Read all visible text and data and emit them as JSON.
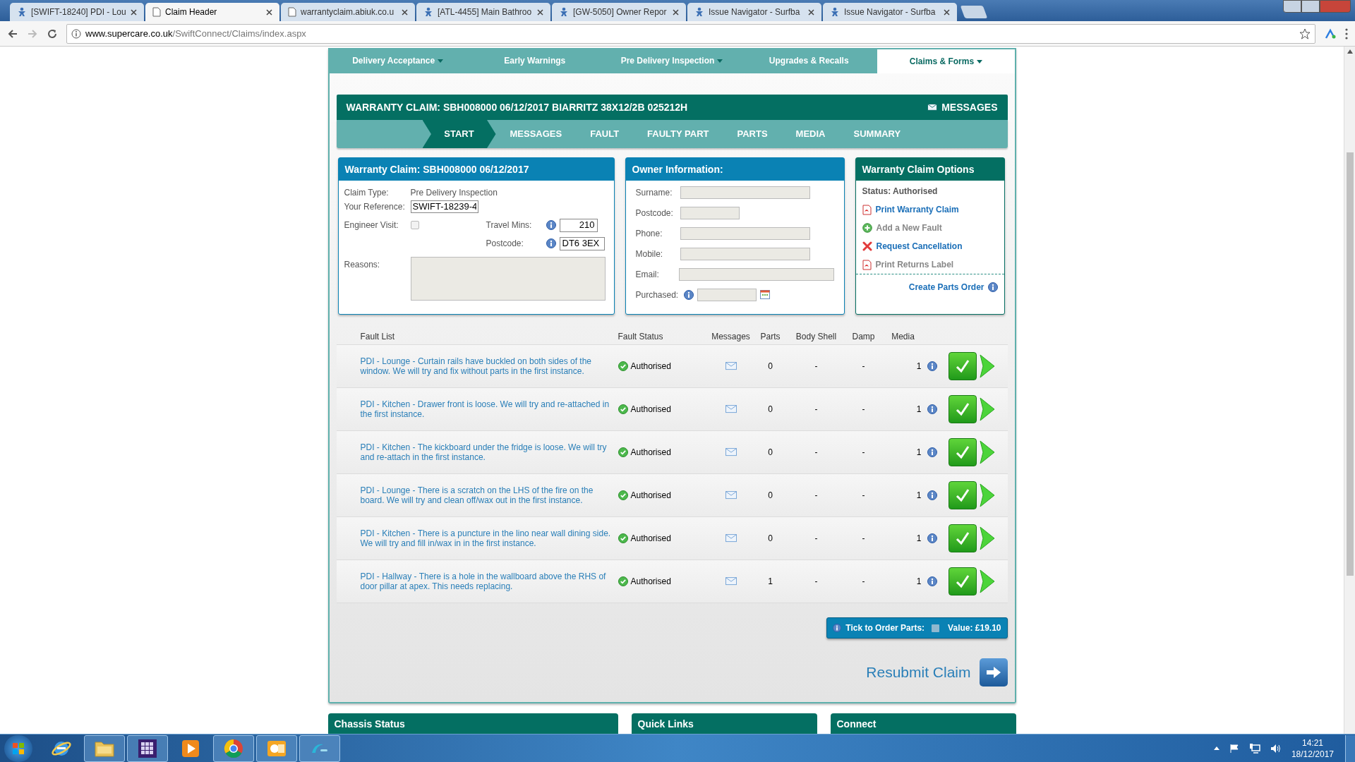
{
  "browser": {
    "tabs": [
      {
        "title": "[SWIFT-18240] PDI - Lou",
        "selected": false,
        "kind": "tracker"
      },
      {
        "title": "Claim Header",
        "selected": true,
        "kind": "page"
      },
      {
        "title": "warrantyclaim.abiuk.co.u",
        "selected": false,
        "kind": "page"
      },
      {
        "title": "[ATL-4455] Main Bathroo",
        "selected": false,
        "kind": "tracker"
      },
      {
        "title": "[GW-5050] Owner Repor",
        "selected": false,
        "kind": "tracker"
      },
      {
        "title": "Issue Navigator - Surfba",
        "selected": false,
        "kind": "tracker"
      },
      {
        "title": "Issue Navigator - Surfba",
        "selected": false,
        "kind": "tracker"
      }
    ],
    "address": {
      "domain": "www.supercare.co.uk",
      "path": "/SwiftConnect/Claims/index.aspx"
    }
  },
  "nav": [
    {
      "label": "Delivery Acceptance",
      "selected": false,
      "dropdown": true
    },
    {
      "label": "Early Warnings",
      "selected": false,
      "dropdown": false
    },
    {
      "label": "Pre Delivery Inspection",
      "selected": false,
      "dropdown": true
    },
    {
      "label": "Upgrades & Recalls",
      "selected": false,
      "dropdown": false
    },
    {
      "label": "Claims & Forms",
      "selected": true,
      "dropdown": true
    }
  ],
  "claim_header": {
    "title": "WARRANTY CLAIM: SBH008000 06/12/2017 BIARRITZ 38X12/2B 025212H",
    "messages_button": "MESSAGES"
  },
  "steps": [
    {
      "label": "START",
      "selected": true
    },
    {
      "label": "MESSAGES",
      "selected": false
    },
    {
      "label": "FAULT",
      "selected": false
    },
    {
      "label": "FAULTY PART",
      "selected": false
    },
    {
      "label": "PARTS",
      "selected": false
    },
    {
      "label": "MEDIA",
      "selected": false
    },
    {
      "label": "SUMMARY",
      "selected": false
    }
  ],
  "claim_panel": {
    "title": "Warranty Claim: SBH008000 06/12/2017",
    "claim_type_label": "Claim Type:",
    "claim_type": "Pre Delivery Inspection",
    "reference_label": "Your Reference:",
    "reference": "SWIFT-18239-4",
    "engineer_visit_label": "Engineer Visit:",
    "engineer_visit": false,
    "travel_mins_label": "Travel Mins:",
    "travel_mins": "210",
    "postcode_label": "Postcode:",
    "postcode": "DT6 3EX",
    "reasons_label": "Reasons:"
  },
  "owner_panel": {
    "title": "Owner Information:",
    "fields": [
      {
        "label": "Surname:",
        "kind": "text"
      },
      {
        "label": "Postcode:",
        "kind": "short"
      },
      {
        "label": "Phone:",
        "kind": "text"
      },
      {
        "label": "Mobile:",
        "kind": "text"
      },
      {
        "label": "Email:",
        "kind": "wide"
      },
      {
        "label": "Purchased:",
        "kind": "date"
      }
    ]
  },
  "options_panel": {
    "title": "Warranty Claim Options",
    "status": "Status: Authorised",
    "links": [
      {
        "label": "Print Warranty Claim",
        "kind": "pdf",
        "disabled": false
      },
      {
        "label": "Add a New Fault",
        "kind": "add",
        "disabled": true
      },
      {
        "label": "Request Cancellation",
        "kind": "cancel",
        "disabled": false
      },
      {
        "label": "Print Returns Label",
        "kind": "pdf",
        "disabled": true
      }
    ],
    "parts_order": "Create Parts Order"
  },
  "fault_table": {
    "columns": [
      "Fault List",
      "Fault Status",
      "Messages",
      "Parts",
      "Body Shell",
      "Damp",
      "Media"
    ],
    "rows": [
      {
        "description": "PDI - Lounge - Curtain rails have buckled on both sides of the window. We will try and fix without parts in the first instance.",
        "status": "Authorised",
        "parts": "0",
        "body_shell": "-",
        "damp": "-",
        "media": "1"
      },
      {
        "description": "PDI - Kitchen - Drawer front is loose. We will try and re-attached in the first instance.",
        "status": "Authorised",
        "parts": "0",
        "body_shell": "-",
        "damp": "-",
        "media": "1"
      },
      {
        "description": "PDI - Kitchen - The kickboard under the fridge is loose. We will try and re-attach in the first instance.",
        "status": "Authorised",
        "parts": "0",
        "body_shell": "-",
        "damp": "-",
        "media": "1"
      },
      {
        "description": "PDI - Lounge - There is a scratch on the LHS of the fire on the board. We will try and clean off/wax out in the first instance.",
        "status": "Authorised",
        "parts": "0",
        "body_shell": "-",
        "damp": "-",
        "media": "1"
      },
      {
        "description": "PDI - Kitchen - There is a puncture in the lino near wall dining side. We will try and fill in/wax in in the first instance.",
        "status": "Authorised",
        "parts": "0",
        "body_shell": "-",
        "damp": "-",
        "media": "1"
      },
      {
        "description": "PDI - Hallway - There is a hole in the wallboard above the RHS of door pillar at apex. This needs replacing.",
        "status": "Authorised",
        "parts": "1",
        "body_shell": "-",
        "damp": "-",
        "media": "1"
      }
    ]
  },
  "order_parts": {
    "label": "Tick to Order Parts:",
    "checked": false,
    "value": "Value: £19.10"
  },
  "resubmit": "Resubmit Claim",
  "bottom_panels": [
    "Chassis Status",
    "Quick Links",
    "Connect"
  ],
  "taskbar": {
    "apps": [
      {
        "kind": "browser",
        "active": false
      },
      {
        "kind": "folder",
        "active": true
      },
      {
        "kind": "grid",
        "active": true
      },
      {
        "kind": "media",
        "active": false
      },
      {
        "kind": "chrome",
        "active": true
      },
      {
        "kind": "mail",
        "active": true
      },
      {
        "kind": "chat",
        "active": true
      }
    ],
    "time": "14:21",
    "date": "18/12/2017"
  }
}
